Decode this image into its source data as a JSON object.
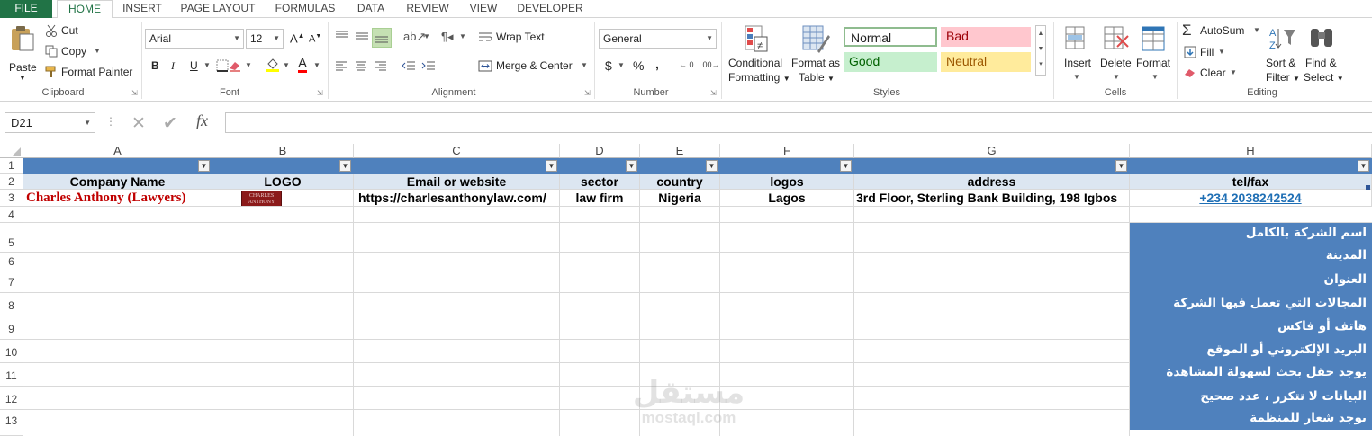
{
  "ribbon_tabs": [
    "FILE",
    "HOME",
    "INSERT",
    "PAGE LAYOUT",
    "FORMULAS",
    "DATA",
    "REVIEW",
    "VIEW",
    "DEVELOPER"
  ],
  "clipboard": {
    "paste": "Paste",
    "cut": "Cut",
    "copy": "Copy",
    "format_painter": "Format Painter",
    "group": "Clipboard"
  },
  "font": {
    "name": "Arial",
    "size": "12",
    "group": "Font",
    "grow": "A",
    "shrink": "A",
    "bold": "B",
    "italic": "I",
    "underline": "U",
    "color_a": "A"
  },
  "alignment": {
    "wrap_text": "Wrap Text",
    "merge_center": "Merge & Center",
    "group": "Alignment"
  },
  "number": {
    "format": "General",
    "currency": "$",
    "percent": "%",
    "comma": ",",
    "group": "Number"
  },
  "styles": {
    "conditional": "Conditional Formatting",
    "conditional_line1": "Conditional",
    "conditional_line2": "Formatting",
    "format_table_line1": "Format as",
    "format_table_line2": "Table",
    "normal": "Normal",
    "bad": "Bad",
    "good": "Good",
    "neutral": "Neutral",
    "group": "Styles"
  },
  "cells": {
    "insert": "Insert",
    "delete": "Delete",
    "format": "Format",
    "group": "Cells"
  },
  "editing": {
    "autosum": "AutoSum",
    "fill": "Fill",
    "clear": "Clear",
    "sort_line1": "Sort &",
    "sort_line2": "Filter",
    "find_line1": "Find &",
    "find_line2": "Select",
    "group": "Editing"
  },
  "formula_bar": {
    "name_box": "D21",
    "fx": "fx",
    "formula": ""
  },
  "columns": [
    "A",
    "B",
    "C",
    "D",
    "E",
    "F",
    "G",
    "H"
  ],
  "rows": [
    "1",
    "2",
    "3",
    "4",
    "5",
    "6",
    "7",
    "8",
    "9",
    "10",
    "11",
    "12",
    "13"
  ],
  "headers": {
    "company": "Company Name",
    "logo": "LOGO",
    "email": "Email or website",
    "sector": "sector",
    "country": "country",
    "logos": "logos",
    "address": "address",
    "telfax": "tel/fax"
  },
  "record": {
    "company": "Charles Anthony (Lawyers)",
    "logo_text_1": "CHARLES",
    "logo_text_2": "ANTHONY",
    "website": "https://charlesanthonylaw.com/",
    "sector": "law firm",
    "country": "Nigeria",
    "city": "Lagos",
    "address": "3rd Floor, Sterling Bank Building, 198 Igbos",
    "tel": "+234 2038242524"
  },
  "notes": [
    "اسم الشركة بالكامل",
    "المدينة",
    "العنوان",
    "المجالات التي تعمل فيها الشركة",
    "هاتف أو فاكس",
    "البريد الإلكتروني أو الموقع",
    "يوجد حقل بحث لسهولة المشاهدة",
    "البيانات لا تتكرر ، عدد صحيح",
    "يوجد شعار للمنظمة"
  ],
  "watermark": {
    "arabic": "مستقل",
    "latin": "mostaql.com"
  },
  "colors": {
    "header_blue": "#4f81bd",
    "light_blue": "#dce6f1",
    "company_red": "#c00000",
    "excel_green": "#217346",
    "link_blue": "#1f6fb5"
  }
}
